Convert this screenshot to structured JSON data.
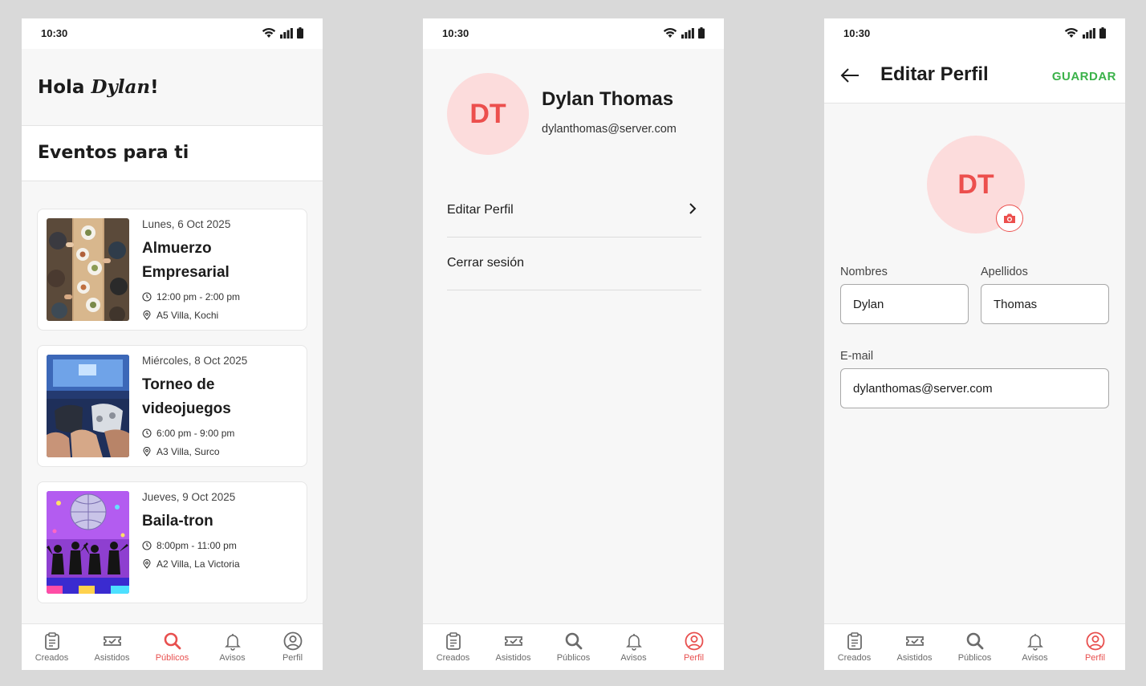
{
  "status": {
    "time": "10:30"
  },
  "home": {
    "greeting_prefix": "Hola",
    "greeting_name": "Dylan",
    "greeting_suffix": "!",
    "section_title": "Eventos para ti",
    "events": [
      {
        "date": "Lunes, 6 Oct 2025",
        "name": "Almuerzo Empresarial",
        "time": "12:00 pm - 2:00 pm",
        "location": "A5 Villa, Kochi",
        "image": "business-lunch-photo"
      },
      {
        "date": "Miércoles, 8 Oct 2025",
        "name": "Torneo de videojuegos",
        "time": "6:00 pm - 9:00 pm",
        "location": "A3 Villa, Surco",
        "image": "videogame-controller-photo"
      },
      {
        "date": "Jueves, 9 Oct 2025",
        "name": "Baila-tron",
        "time": "8:00pm - 11:00 pm",
        "location": "A2 Villa, La Victoria",
        "image": "disco-dance-illustration"
      }
    ]
  },
  "nav": {
    "items": [
      {
        "label": "Creados",
        "icon": "clipboard-icon"
      },
      {
        "label": "Asistidos",
        "icon": "ticket-check-icon"
      },
      {
        "label": "Públicos",
        "icon": "search-icon"
      },
      {
        "label": "Avisos",
        "icon": "bell-icon"
      },
      {
        "label": "Perfil",
        "icon": "user-circle-icon"
      }
    ],
    "active_color": "#e8504f",
    "inactive_color": "#6b6b6b"
  },
  "profile": {
    "initials": "DT",
    "name": "Dylan Thomas",
    "email": "dylanthomas@server.com",
    "menu": [
      "Editar Perfil",
      "Cerrar sesión"
    ]
  },
  "edit": {
    "title": "Editar Perfil",
    "save_label": "GUARDAR",
    "initials": "DT",
    "nombres_label": "Nombres",
    "nombres_value": "Dylan",
    "apellidos_label": "Apellidos",
    "apellidos_value": "Thomas",
    "email_label": "E-mail",
    "email_value": "dylanthomas@server.com"
  },
  "colors": {
    "accent": "#ec4f4d",
    "avatar_bg": "#fcdcdc",
    "save": "#3bb24a"
  }
}
